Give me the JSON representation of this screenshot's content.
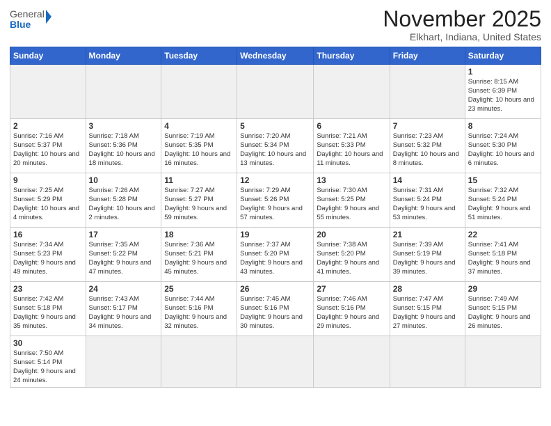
{
  "logo": {
    "text_general": "General",
    "text_blue": "Blue"
  },
  "title": {
    "month_year": "November 2025",
    "location": "Elkhart, Indiana, United States"
  },
  "days_of_week": [
    "Sunday",
    "Monday",
    "Tuesday",
    "Wednesday",
    "Thursday",
    "Friday",
    "Saturday"
  ],
  "weeks": [
    [
      {
        "num": "",
        "info": ""
      },
      {
        "num": "",
        "info": ""
      },
      {
        "num": "",
        "info": ""
      },
      {
        "num": "",
        "info": ""
      },
      {
        "num": "",
        "info": ""
      },
      {
        "num": "",
        "info": ""
      },
      {
        "num": "1",
        "info": "Sunrise: 8:15 AM\nSunset: 6:39 PM\nDaylight: 10 hours and 23 minutes."
      }
    ],
    [
      {
        "num": "2",
        "info": "Sunrise: 7:16 AM\nSunset: 5:37 PM\nDaylight: 10 hours and 20 minutes."
      },
      {
        "num": "3",
        "info": "Sunrise: 7:18 AM\nSunset: 5:36 PM\nDaylight: 10 hours and 18 minutes."
      },
      {
        "num": "4",
        "info": "Sunrise: 7:19 AM\nSunset: 5:35 PM\nDaylight: 10 hours and 16 minutes."
      },
      {
        "num": "5",
        "info": "Sunrise: 7:20 AM\nSunset: 5:34 PM\nDaylight: 10 hours and 13 minutes."
      },
      {
        "num": "6",
        "info": "Sunrise: 7:21 AM\nSunset: 5:33 PM\nDaylight: 10 hours and 11 minutes."
      },
      {
        "num": "7",
        "info": "Sunrise: 7:23 AM\nSunset: 5:32 PM\nDaylight: 10 hours and 8 minutes."
      },
      {
        "num": "8",
        "info": "Sunrise: 7:24 AM\nSunset: 5:30 PM\nDaylight: 10 hours and 6 minutes."
      }
    ],
    [
      {
        "num": "9",
        "info": "Sunrise: 7:25 AM\nSunset: 5:29 PM\nDaylight: 10 hours and 4 minutes."
      },
      {
        "num": "10",
        "info": "Sunrise: 7:26 AM\nSunset: 5:28 PM\nDaylight: 10 hours and 2 minutes."
      },
      {
        "num": "11",
        "info": "Sunrise: 7:27 AM\nSunset: 5:27 PM\nDaylight: 9 hours and 59 minutes."
      },
      {
        "num": "12",
        "info": "Sunrise: 7:29 AM\nSunset: 5:26 PM\nDaylight: 9 hours and 57 minutes."
      },
      {
        "num": "13",
        "info": "Sunrise: 7:30 AM\nSunset: 5:25 PM\nDaylight: 9 hours and 55 minutes."
      },
      {
        "num": "14",
        "info": "Sunrise: 7:31 AM\nSunset: 5:24 PM\nDaylight: 9 hours and 53 minutes."
      },
      {
        "num": "15",
        "info": "Sunrise: 7:32 AM\nSunset: 5:24 PM\nDaylight: 9 hours and 51 minutes."
      }
    ],
    [
      {
        "num": "16",
        "info": "Sunrise: 7:34 AM\nSunset: 5:23 PM\nDaylight: 9 hours and 49 minutes."
      },
      {
        "num": "17",
        "info": "Sunrise: 7:35 AM\nSunset: 5:22 PM\nDaylight: 9 hours and 47 minutes."
      },
      {
        "num": "18",
        "info": "Sunrise: 7:36 AM\nSunset: 5:21 PM\nDaylight: 9 hours and 45 minutes."
      },
      {
        "num": "19",
        "info": "Sunrise: 7:37 AM\nSunset: 5:20 PM\nDaylight: 9 hours and 43 minutes."
      },
      {
        "num": "20",
        "info": "Sunrise: 7:38 AM\nSunset: 5:20 PM\nDaylight: 9 hours and 41 minutes."
      },
      {
        "num": "21",
        "info": "Sunrise: 7:39 AM\nSunset: 5:19 PM\nDaylight: 9 hours and 39 minutes."
      },
      {
        "num": "22",
        "info": "Sunrise: 7:41 AM\nSunset: 5:18 PM\nDaylight: 9 hours and 37 minutes."
      }
    ],
    [
      {
        "num": "23",
        "info": "Sunrise: 7:42 AM\nSunset: 5:18 PM\nDaylight: 9 hours and 35 minutes."
      },
      {
        "num": "24",
        "info": "Sunrise: 7:43 AM\nSunset: 5:17 PM\nDaylight: 9 hours and 34 minutes."
      },
      {
        "num": "25",
        "info": "Sunrise: 7:44 AM\nSunset: 5:16 PM\nDaylight: 9 hours and 32 minutes."
      },
      {
        "num": "26",
        "info": "Sunrise: 7:45 AM\nSunset: 5:16 PM\nDaylight: 9 hours and 30 minutes."
      },
      {
        "num": "27",
        "info": "Sunrise: 7:46 AM\nSunset: 5:16 PM\nDaylight: 9 hours and 29 minutes."
      },
      {
        "num": "28",
        "info": "Sunrise: 7:47 AM\nSunset: 5:15 PM\nDaylight: 9 hours and 27 minutes."
      },
      {
        "num": "29",
        "info": "Sunrise: 7:49 AM\nSunset: 5:15 PM\nDaylight: 9 hours and 26 minutes."
      }
    ],
    [
      {
        "num": "30",
        "info": "Sunrise: 7:50 AM\nSunset: 5:14 PM\nDaylight: 9 hours and 24 minutes."
      },
      {
        "num": "",
        "info": ""
      },
      {
        "num": "",
        "info": ""
      },
      {
        "num": "",
        "info": ""
      },
      {
        "num": "",
        "info": ""
      },
      {
        "num": "",
        "info": ""
      },
      {
        "num": "",
        "info": ""
      }
    ]
  ]
}
